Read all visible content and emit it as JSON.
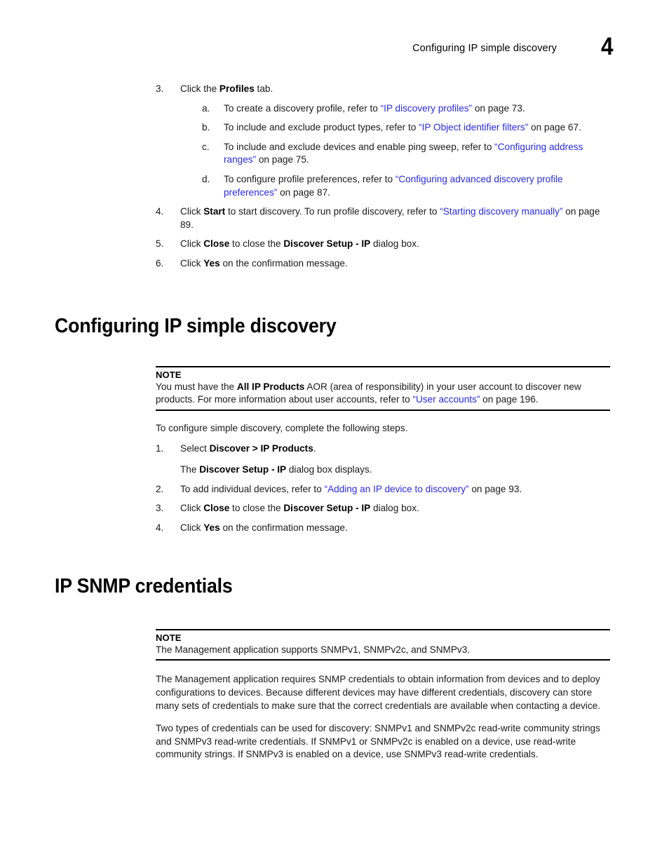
{
  "header": {
    "title": "Configuring IP simple discovery",
    "folio": "4"
  },
  "top_list": {
    "items": [
      {
        "marker": "3.",
        "text_html": "Click the <b>Profiles</b> tab.",
        "sub": [
          {
            "marker": "a.",
            "text_html": "To create a discovery profile, refer to <span class=\"lnk\">“IP discovery profiles”</span> on page 73."
          },
          {
            "marker": "b.",
            "text_html": "To include and exclude product types, refer to <span class=\"lnk\">“IP Object identifier filters”</span> on page 67."
          },
          {
            "marker": "c.",
            "text_html": "To include and exclude devices and enable ping sweep, refer to <span class=\"lnk\">“Configuring address ranges”</span> on page 75."
          },
          {
            "marker": "d.",
            "text_html": "To configure profile preferences, refer to <span class=\"lnk\">“Configuring advanced discovery profile preferences”</span> on page 87."
          }
        ]
      },
      {
        "marker": "4.",
        "text_html": "Click <b>Start</b> to start discovery. To run profile discovery, refer to <span class=\"lnk\">“Starting discovery manually”</span> on page 89."
      },
      {
        "marker": "5.",
        "text_html": "Click <b>Close</b> to close the <b>Discover Setup - IP</b> dialog box."
      },
      {
        "marker": "6.",
        "text_html": "Click <b>Yes</b> on the confirmation message."
      }
    ]
  },
  "section_1": {
    "heading": "Configuring IP simple discovery",
    "note": {
      "label": "NOTE",
      "body_html": "You must have the <b>All IP Products</b> AOR (area of responsibility) in your user account to discover new products. For more information about user accounts, refer to <span class=\"lnk\">“User accounts”</span> on page 196."
    },
    "intro": "To configure simple discovery, complete the following steps.",
    "steps": [
      {
        "marker": "1.",
        "text_html": "Select <b>Discover &gt; IP Products</b>.",
        "continuation_html": "The <b>Discover Setup - IP</b> dialog box displays."
      },
      {
        "marker": "2.",
        "text_html": "To add individual devices, refer to <span class=\"lnk\">“Adding an IP device to discovery”</span> on page 93."
      },
      {
        "marker": "3.",
        "text_html": "Click <b>Close</b> to close the <b>Discover Setup - IP</b> dialog box."
      },
      {
        "marker": "4.",
        "text_html": "Click <b>Yes</b> on the confirmation message."
      }
    ]
  },
  "section_2": {
    "heading": "IP SNMP credentials",
    "note": {
      "label": "NOTE",
      "body_html": "The Management application supports SNMPv1, SNMPv2c, and SNMPv3."
    },
    "paragraphs": [
      "The Management application requires SNMP credentials to obtain information from devices and to deploy configurations to devices. Because different devices may have different credentials, discovery can store many sets of credentials to make sure that the correct credentials are available when contacting a device.",
      "Two types of credentials can be used for discovery: SNMPv1 and SNMPv2c read-write community strings and SNMPv3 read-write credentials. If SNMPv1 or SNMPv2c is enabled on a device, use read-write community strings. If SNMPv3 is enabled on a device, use SNMPv3 read-write credentials."
    ]
  },
  "colors": {
    "link": "#2a2ae8",
    "text": "#1a1a1a",
    "rule": "#000000"
  }
}
